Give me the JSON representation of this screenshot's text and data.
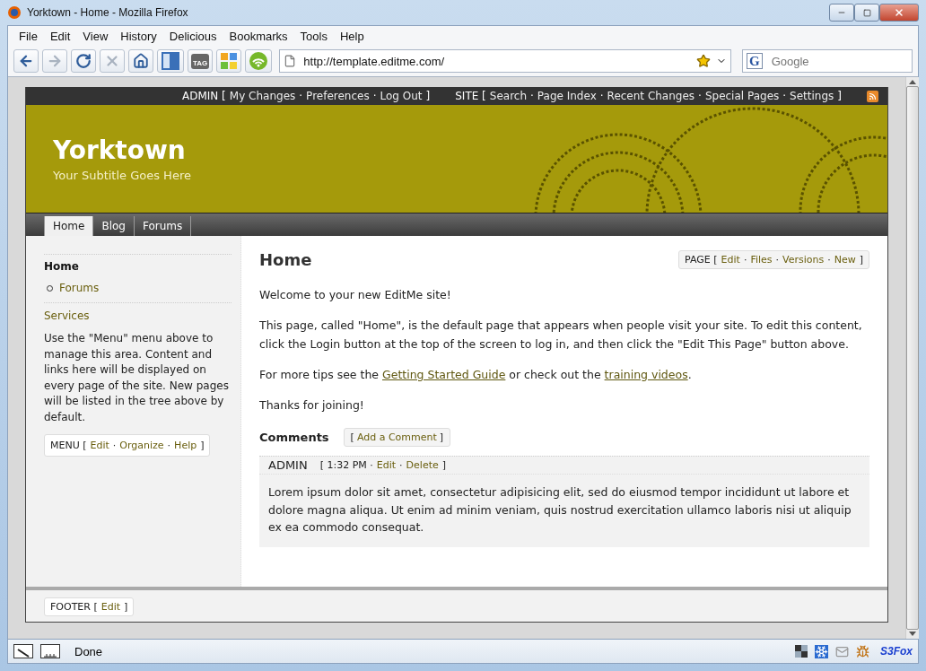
{
  "window": {
    "title": "Yorktown - Home - Mozilla Firefox"
  },
  "menu": [
    "File",
    "Edit",
    "View",
    "History",
    "Delicious",
    "Bookmarks",
    "Tools",
    "Help"
  ],
  "toolbar": [
    {
      "kind": "back",
      "disabled": false
    },
    {
      "kind": "forward",
      "disabled": true
    },
    {
      "kind": "reload",
      "disabled": false
    },
    {
      "kind": "stop",
      "disabled": true
    },
    {
      "kind": "home",
      "disabled": false
    },
    {
      "kind": "bookmark"
    },
    {
      "kind": "tag",
      "label": "TAG"
    },
    {
      "kind": "tiles"
    },
    {
      "kind": "signal"
    }
  ],
  "address": {
    "value": "http://template.editme.com/"
  },
  "search": {
    "engine": "G",
    "placeholder": "Google"
  },
  "site": {
    "top_groups": [
      [
        {
          "kind": "text",
          "text": "ADMIN ["
        },
        {
          "kind": "link",
          "text": "My Changes"
        },
        {
          "kind": "text",
          "text": "·"
        },
        {
          "kind": "link",
          "text": "Preferences"
        },
        {
          "kind": "text",
          "text": "·"
        },
        {
          "kind": "link",
          "text": "Log Out"
        },
        {
          "kind": "text",
          "text": "]"
        }
      ],
      [
        {
          "kind": "text",
          "text": "SITE ["
        },
        {
          "kind": "link",
          "text": "Search"
        },
        {
          "kind": "text",
          "text": "·"
        },
        {
          "kind": "link",
          "text": "Page Index"
        },
        {
          "kind": "text",
          "text": "·"
        },
        {
          "kind": "link",
          "text": "Recent Changes"
        },
        {
          "kind": "text",
          "text": "·"
        },
        {
          "kind": "link",
          "text": "Special Pages"
        },
        {
          "kind": "text",
          "text": "·"
        },
        {
          "kind": "link",
          "text": "Settings"
        },
        {
          "kind": "text",
          "text": "]"
        }
      ]
    ],
    "title": "Yorktown",
    "subtitle": "Your Subtitle Goes Here",
    "tabs": [
      {
        "label": "Home",
        "selected": true
      },
      {
        "label": "Blog",
        "selected": false
      },
      {
        "label": "Forums",
        "selected": false
      }
    ],
    "sidebar": {
      "tree": [
        {
          "label": "Home",
          "selected": true,
          "children": [
            {
              "label": "Forums",
              "selected": false
            }
          ]
        }
      ],
      "heading": "Services",
      "text": "Use the \"Menu\" menu above to manage this area. Content and links here will be displayed on every page of the site. New pages will be listed in the tree above by default.",
      "tools": [
        {
          "kind": "text",
          "text": "MENU ["
        },
        {
          "kind": "link",
          "text": "Edit"
        },
        {
          "kind": "text",
          "text": "·"
        },
        {
          "kind": "link",
          "text": "Organize"
        },
        {
          "kind": "text",
          "text": "·"
        },
        {
          "kind": "link",
          "text": "Help"
        },
        {
          "kind": "text",
          "text": "]"
        }
      ]
    },
    "page": {
      "title": "Home",
      "tools": [
        {
          "kind": "text",
          "text": "PAGE ["
        },
        {
          "kind": "link",
          "text": "Edit"
        },
        {
          "kind": "text",
          "text": "·"
        },
        {
          "kind": "link",
          "text": "Files"
        },
        {
          "kind": "text",
          "text": "·"
        },
        {
          "kind": "link",
          "text": "Versions"
        },
        {
          "kind": "text",
          "text": "·"
        },
        {
          "kind": "link",
          "text": "New"
        },
        {
          "kind": "text",
          "text": "]"
        }
      ],
      "paragraphs": [
        [
          {
            "kind": "text",
            "text": "Welcome to your new EditMe site!"
          }
        ],
        [
          {
            "kind": "text",
            "text": "This page, called \"Home\", is the default page that appears when people visit your site. To edit this content, click the Login button at the top of the screen to log in, and then click the \"Edit This Page\" button above."
          }
        ],
        [
          {
            "kind": "text",
            "text": "For more tips see the "
          },
          {
            "kind": "link",
            "text": "Getting Started Guide"
          },
          {
            "kind": "text",
            "text": " or check out the "
          },
          {
            "kind": "link",
            "text": "training videos"
          },
          {
            "kind": "text",
            "text": "."
          }
        ],
        [
          {
            "kind": "text",
            "text": "Thanks for joining!"
          }
        ]
      ],
      "comments": {
        "heading": "Comments",
        "add": [
          {
            "kind": "text",
            "text": "["
          },
          {
            "kind": "link",
            "text": "Add a Comment"
          },
          {
            "kind": "text",
            "text": "]"
          }
        ],
        "items": [
          {
            "author": "ADMIN",
            "meta": [
              {
                "kind": "text",
                "text": "[ 1:32 PM ·"
              },
              {
                "kind": "link",
                "text": "Edit"
              },
              {
                "kind": "text",
                "text": "·"
              },
              {
                "kind": "link",
                "text": "Delete"
              },
              {
                "kind": "text",
                "text": "]"
              }
            ],
            "body": "Lorem ipsum dolor sit amet, consectetur adipisicing elit, sed do eiusmod tempor incididunt ut labore et dolore magna aliqua. Ut enim ad minim veniam, quis nostrud exercitation ullamco laboris nisi ut aliquip ex ea commodo consequat."
          }
        ]
      }
    },
    "footer": [
      {
        "kind": "text",
        "text": "FOOTER ["
      },
      {
        "kind": "link",
        "text": "Edit"
      },
      {
        "kind": "text",
        "text": "]"
      }
    ]
  },
  "status": {
    "text": "Done",
    "logo": "S3Fox"
  }
}
